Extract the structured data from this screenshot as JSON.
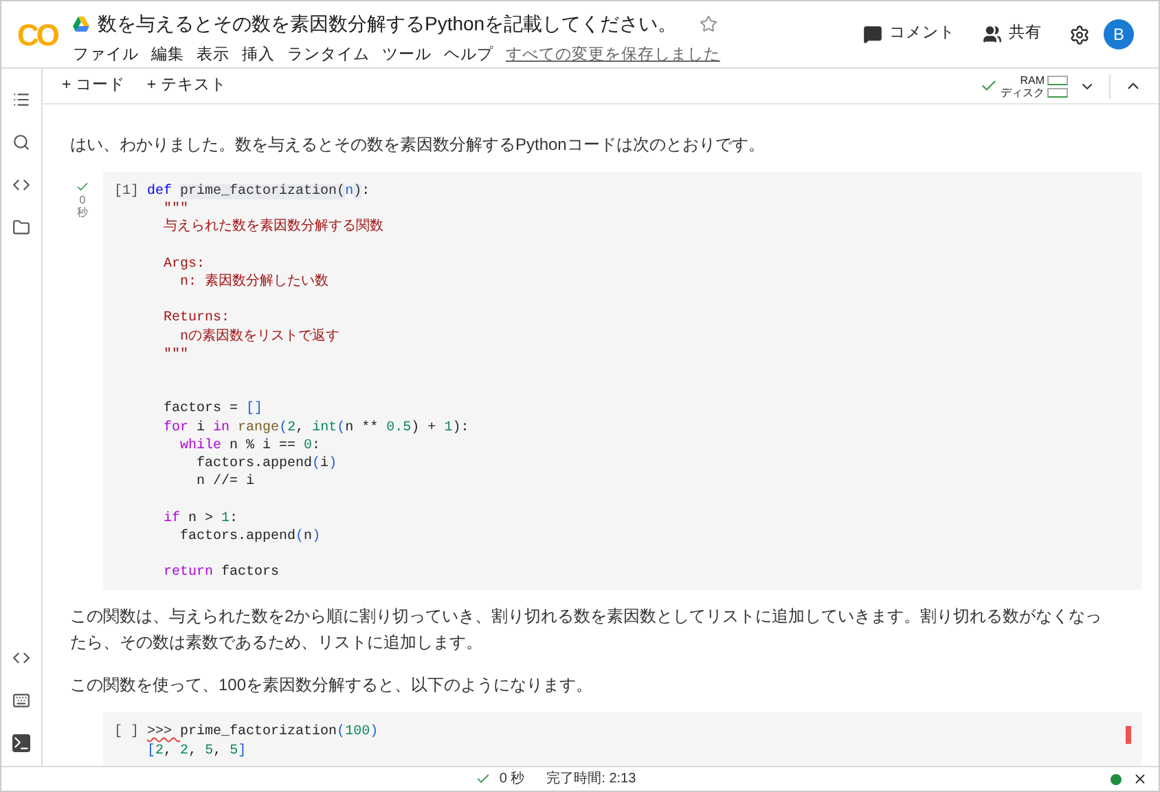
{
  "header": {
    "logo": "CO",
    "title": "数を与えるとその数を素因数分解するPythonを記載してください。",
    "starred": false,
    "menu": [
      "ファイル",
      "編集",
      "表示",
      "挿入",
      "ランタイム",
      "ツール",
      "ヘルプ"
    ],
    "save_status": "すべての変更を保存しました",
    "comment": "コメント",
    "share": "共有",
    "avatar": "B"
  },
  "toolbar": {
    "add_code": "+ コード",
    "add_text": "+ テキスト",
    "ram": "RAM",
    "disk": "ディスク"
  },
  "cells": [
    {
      "kind": "text",
      "text": "はい、わかりました。数を与えるとその数を素因数分解するPythonコードは次のとおりです。"
    },
    {
      "kind": "code",
      "run_label": "[1]",
      "executed": true,
      "exec_time": "0",
      "exec_unit": "秒",
      "lines": [
        {
          "kind": "code",
          "tokens": [
            {
              "text": "def ",
              "kind": "keyword"
            },
            {
              "text": "prime_factorization",
              "kind": "function"
            },
            {
              "text": "(",
              "kind": "function"
            },
            {
              "text": "n",
              "kind": "bracket"
            },
            {
              "text": ")",
              "kind": "function"
            },
            {
              "text": ":",
              "kind": "plain"
            }
          ]
        },
        {
          "kind": "code",
          "tokens": [
            {
              "text": "  \"\"\"",
              "kind": "string"
            }
          ]
        },
        {
          "kind": "code",
          "tokens": [
            {
              "text": "  与えられた数を素因数分解する関数",
              "kind": "string"
            }
          ]
        },
        {
          "kind": "blank"
        },
        {
          "kind": "code",
          "tokens": [
            {
              "text": "  Args:",
              "kind": "string"
            }
          ]
        },
        {
          "kind": "code",
          "tokens": [
            {
              "text": "    n: 素因数分解したい数",
              "kind": "string"
            }
          ]
        },
        {
          "kind": "blank"
        },
        {
          "kind": "code",
          "tokens": [
            {
              "text": "  Returns:",
              "kind": "string"
            }
          ]
        },
        {
          "kind": "code",
          "tokens": [
            {
              "text": "    nの素因数をリストで返す",
              "kind": "string"
            }
          ]
        },
        {
          "kind": "code",
          "tokens": [
            {
              "text": "  \"\"\"",
              "kind": "string"
            }
          ]
        },
        {
          "kind": "blank"
        },
        {
          "kind": "blank"
        },
        {
          "kind": "code",
          "tokens": [
            {
              "text": "  factors = ",
              "kind": "plain"
            },
            {
              "text": "[]",
              "kind": "bracket"
            }
          ]
        },
        {
          "kind": "code",
          "tokens": [
            {
              "text": "  for ",
              "kind": "control"
            },
            {
              "text": "i ",
              "kind": "plain"
            },
            {
              "text": "in ",
              "kind": "control"
            },
            {
              "text": "range",
              "kind": "builtin"
            },
            {
              "text": "(",
              "kind": "bracket"
            },
            {
              "text": "2",
              "kind": "number"
            },
            {
              "text": ", ",
              "kind": "plain"
            },
            {
              "text": "int",
              "kind": "number"
            },
            {
              "text": "(",
              "kind": "bracket"
            },
            {
              "text": "n ** ",
              "kind": "plain"
            },
            {
              "text": "0.5",
              "kind": "number"
            },
            {
              "text": ") + ",
              "kind": "plain"
            },
            {
              "text": "1",
              "kind": "number"
            },
            {
              "text": "):",
              "kind": "plain"
            }
          ]
        },
        {
          "kind": "code",
          "tokens": [
            {
              "text": "    while ",
              "kind": "control"
            },
            {
              "text": "n % i == ",
              "kind": "plain"
            },
            {
              "text": "0",
              "kind": "number"
            },
            {
              "text": ":",
              "kind": "plain"
            }
          ]
        },
        {
          "kind": "code",
          "tokens": [
            {
              "text": "      factors.append",
              "kind": "plain"
            },
            {
              "text": "(",
              "kind": "bracket"
            },
            {
              "text": "i",
              "kind": "plain"
            },
            {
              "text": ")",
              "kind": "bracket"
            }
          ]
        },
        {
          "kind": "code",
          "tokens": [
            {
              "text": "      n //= i",
              "kind": "plain"
            }
          ]
        },
        {
          "kind": "blank"
        },
        {
          "kind": "code",
          "tokens": [
            {
              "text": "  if ",
              "kind": "control"
            },
            {
              "text": "n > ",
              "kind": "plain"
            },
            {
              "text": "1",
              "kind": "number"
            },
            {
              "text": ":",
              "kind": "plain"
            }
          ]
        },
        {
          "kind": "code",
          "tokens": [
            {
              "text": "    factors.append",
              "kind": "plain"
            },
            {
              "text": "(",
              "kind": "bracket"
            },
            {
              "text": "n",
              "kind": "plain"
            },
            {
              "text": ")",
              "kind": "bracket"
            }
          ]
        },
        {
          "kind": "blank"
        },
        {
          "kind": "code",
          "tokens": [
            {
              "text": "  return ",
              "kind": "control"
            },
            {
              "text": "factors",
              "kind": "plain"
            }
          ]
        }
      ]
    },
    {
      "kind": "text",
      "text": "この関数は、与えられた数を2から順に割り切っていき、割り切れる数を素因数としてリストに追加していきます。割り切れる数がなくなったら、その数は素数であるため、リストに追加します。"
    },
    {
      "kind": "text",
      "text": "この関数を使って、100を素因数分解すると、以下のようになります。"
    },
    {
      "kind": "code",
      "run_label": "[ ]",
      "executed": false,
      "lines": [
        {
          "kind": "code",
          "tokens": [
            {
              "text": ">>> ",
              "kind": "error"
            },
            {
              "text": "prime_factorization",
              "kind": "plain"
            },
            {
              "text": "(",
              "kind": "bracket"
            },
            {
              "text": "100",
              "kind": "number"
            },
            {
              "text": ")",
              "kind": "bracket"
            }
          ]
        },
        {
          "kind": "code",
          "tokens": [
            {
              "text": "[",
              "kind": "bracket"
            },
            {
              "text": "2",
              "kind": "number"
            },
            {
              "text": ", ",
              "kind": "plain"
            },
            {
              "text": "2",
              "kind": "number"
            },
            {
              "text": ", ",
              "kind": "plain"
            },
            {
              "text": "5",
              "kind": "number"
            },
            {
              "text": ", ",
              "kind": "plain"
            },
            {
              "text": "5",
              "kind": "number"
            },
            {
              "text": "]",
              "kind": "bracket"
            }
          ]
        }
      ]
    }
  ],
  "status_bar": {
    "done": true,
    "time": "0 秒",
    "completed": "完了時間: 2:13",
    "connected": true
  }
}
